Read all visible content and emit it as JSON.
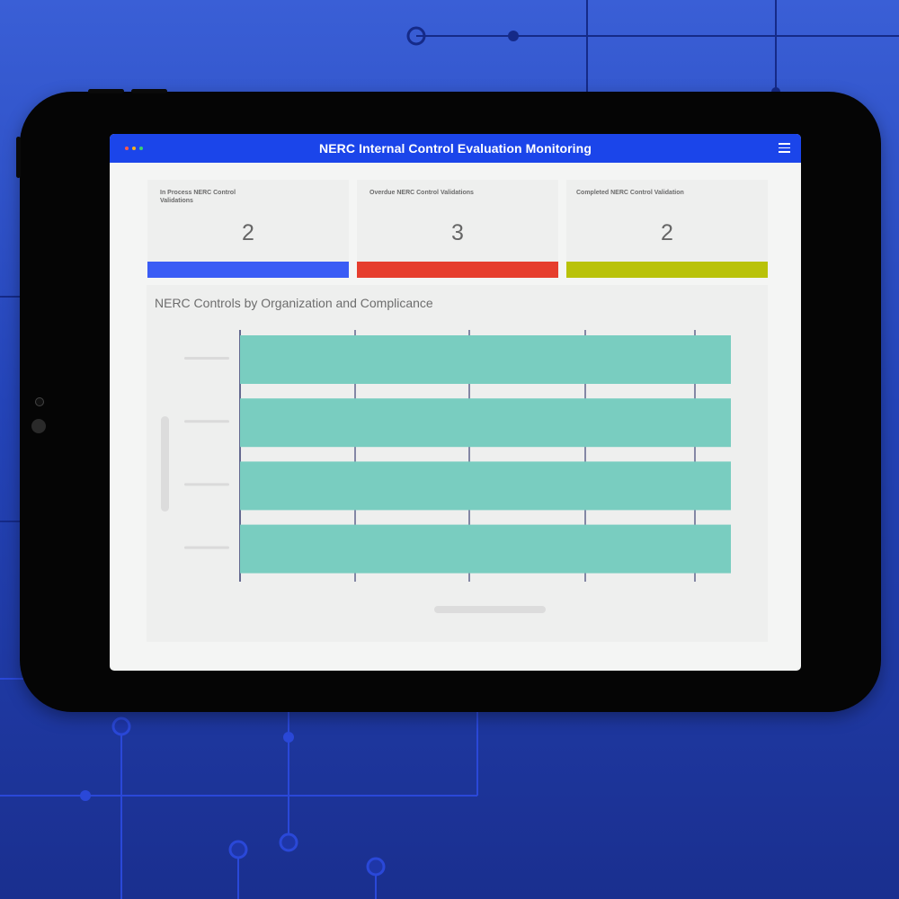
{
  "window": {
    "title": "NERC Internal Control Evaluation Monitoring",
    "dot_colors": [
      "#ff5a4a",
      "#f7b21e",
      "#3bd16f"
    ]
  },
  "cards": [
    {
      "label": "In Process NERC Control Validations",
      "value": "2",
      "color": "#3a5cf5"
    },
    {
      "label": "Overdue NERC Control Validations",
      "value": "3",
      "color": "#e63e2e"
    },
    {
      "label": "Completed NERC Control Validation",
      "value": "2",
      "color": "#b9c20a"
    }
  ],
  "chart_data": {
    "type": "bar",
    "orientation": "horizontal",
    "title": "NERC Controls by Organization and Complicance",
    "categories": [
      "",
      "",
      "",
      ""
    ],
    "values": [
      1,
      1,
      1,
      1
    ],
    "bar_color": "#79cdc0",
    "grid": true,
    "gridline_color": "#1a1f5c"
  },
  "icons": {
    "menu": "hamburger-menu-icon"
  }
}
